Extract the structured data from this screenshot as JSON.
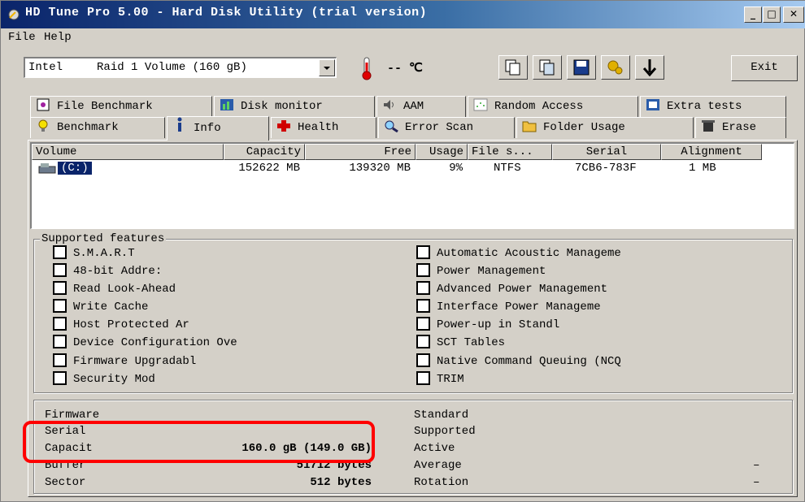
{
  "window": {
    "title": "HD Tune Pro 5.00 - Hard Disk Utility (trial version)"
  },
  "menu": {
    "items": [
      {
        "label": "File"
      },
      {
        "label": "Help"
      }
    ]
  },
  "toolbar": {
    "drive_label": "Intel     Raid 1 Volume (160 gB)",
    "temperature": "-- ℃",
    "exit_label": "Exit"
  },
  "tabs": {
    "row1": [
      {
        "label": "File Benchmark",
        "icon": "file-benchmark-icon"
      },
      {
        "label": "Disk monitor",
        "icon": "disk-monitor-icon"
      },
      {
        "label": "AAM",
        "icon": "speaker-icon"
      },
      {
        "label": "Random Access",
        "icon": "random-access-icon"
      },
      {
        "label": "Extra tests",
        "icon": "extra-tests-icon"
      }
    ],
    "row2": [
      {
        "label": "Benchmark",
        "icon": "lightbulb-icon"
      },
      {
        "label": "Info",
        "icon": "info-icon",
        "active": true
      },
      {
        "label": "Health",
        "icon": "health-cross-icon"
      },
      {
        "label": "Error Scan",
        "icon": "magnifier-icon"
      },
      {
        "label": "Folder Usage",
        "icon": "folder-icon"
      },
      {
        "label": "Erase",
        "icon": "trash-icon"
      }
    ]
  },
  "volumes": {
    "headers": [
      "Volume",
      "Capacity",
      "Free",
      "Usage",
      "File s...",
      "Serial",
      "Alignment"
    ],
    "rows": [
      {
        "volume": "(C:)",
        "capacity": "152622 MB",
        "free": "139320 MB",
        "usage": "9%",
        "fs": "NTFS",
        "serial": "7CB6-783F",
        "alignment": "1 MB"
      }
    ]
  },
  "features": {
    "title": "Supported features",
    "left": [
      "S.M.A.R.T",
      "48-bit Addre:",
      "Read Look-Ahead",
      "Write Cache",
      "Host Protected Ar",
      "Device Configuration Ove",
      "Firmware Upgradabl",
      "Security Mod"
    ],
    "right": [
      "Automatic Acoustic Manageme",
      "Power Management",
      "Advanced Power Management",
      "Interface Power Manageme",
      "Power-up in Standl",
      "SCT Tables",
      "Native Command Queuing (NCQ",
      "TRIM"
    ]
  },
  "info": {
    "left_labels": [
      "Firmware",
      "Serial",
      "Capacit",
      "Buffer",
      "Sector"
    ],
    "left_values": [
      "",
      "",
      "160.0 gB (149.0 GB)",
      "51712 bytes",
      "512 bytes"
    ],
    "right_labels": [
      "Standard",
      "Supported",
      "Active",
      "Average",
      "Rotation"
    ],
    "right_values": [
      "",
      "",
      "",
      "–",
      "–"
    ]
  },
  "colors": {
    "titlebar_start": "#0a246a",
    "window_bg": "#d4d0c8",
    "highlight": "#ff0000",
    "selection": "#0a246a"
  }
}
